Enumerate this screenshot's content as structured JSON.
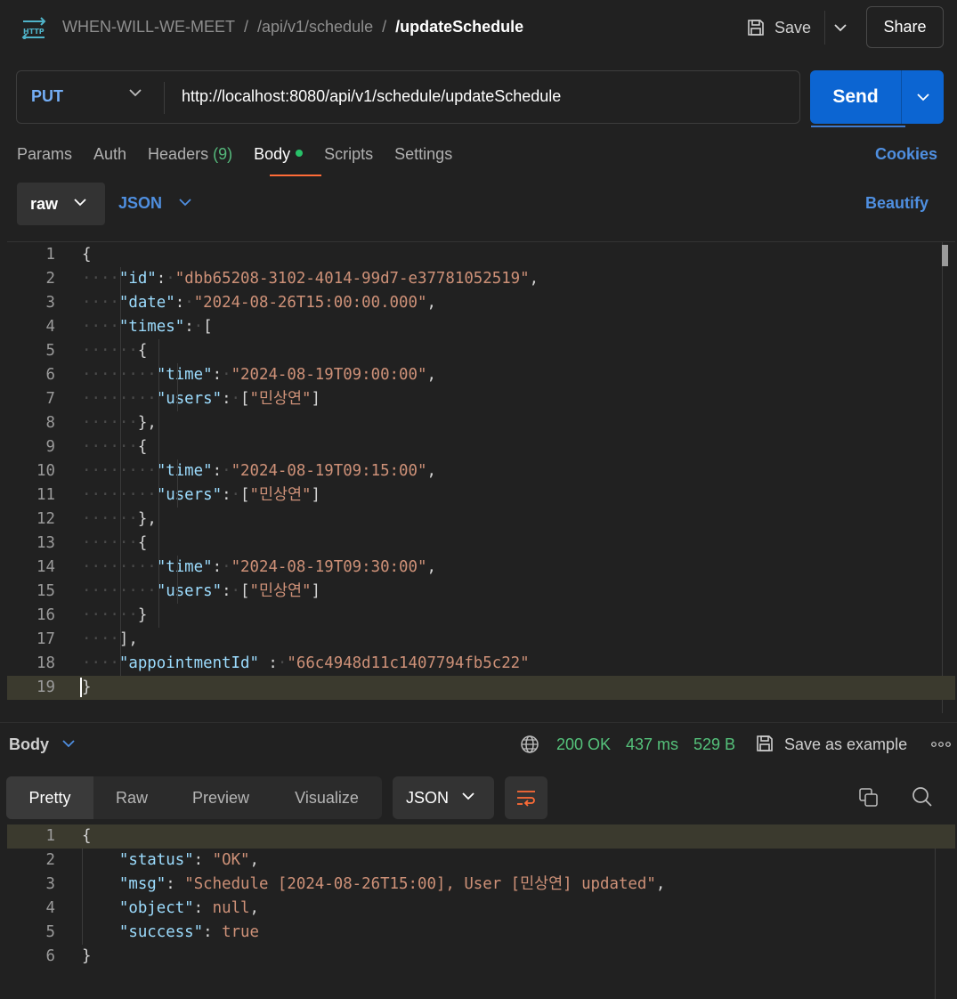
{
  "header": {
    "icon": "http-icon",
    "breadcrumbs": [
      "WHEN-WILL-WE-MEET",
      "/api/v1/schedule",
      "/updateSchedule"
    ],
    "separator": "/",
    "save_label": "Save",
    "share_label": "Share"
  },
  "request": {
    "method": "PUT",
    "url": "http://localhost:8080/api/v1/schedule/updateSchedule",
    "send_label": "Send"
  },
  "tabs": {
    "items": [
      {
        "label": "Params"
      },
      {
        "label": "Auth"
      },
      {
        "label": "Headers",
        "count": "(9)"
      },
      {
        "label": "Body",
        "active": true
      },
      {
        "label": "Scripts"
      },
      {
        "label": "Settings"
      }
    ],
    "cookies_label": "Cookies"
  },
  "body_options": {
    "mode": "raw",
    "language": "JSON",
    "beautify_label": "Beautify"
  },
  "request_body": {
    "lines": [
      {
        "n": "1",
        "text": "{"
      },
      {
        "n": "2",
        "text": "    \"id\": \"dbb65208-3102-4014-99d7-e37781052519\","
      },
      {
        "n": "3",
        "text": "    \"date\": \"2024-08-26T15:00:00.000\","
      },
      {
        "n": "4",
        "text": "    \"times\": ["
      },
      {
        "n": "5",
        "text": "      {"
      },
      {
        "n": "6",
        "text": "        \"time\": \"2024-08-19T09:00:00\","
      },
      {
        "n": "7",
        "text": "        \"users\": [\"민상연\"]"
      },
      {
        "n": "8",
        "text": "      },"
      },
      {
        "n": "9",
        "text": "      {"
      },
      {
        "n": "10",
        "text": "        \"time\": \"2024-08-19T09:15:00\","
      },
      {
        "n": "11",
        "text": "        \"users\": [\"민상연\"]"
      },
      {
        "n": "12",
        "text": "      },"
      },
      {
        "n": "13",
        "text": "      {"
      },
      {
        "n": "14",
        "text": "        \"time\": \"2024-08-19T09:30:00\","
      },
      {
        "n": "15",
        "text": "        \"users\": [\"민상연\"]"
      },
      {
        "n": "16",
        "text": "      }"
      },
      {
        "n": "17",
        "text": "    ],"
      },
      {
        "n": "18",
        "text": "    \"appointmentId\" : \"66c4948d11c1407794fb5c22\""
      },
      {
        "n": "19",
        "text": "}"
      }
    ]
  },
  "response": {
    "label": "Body",
    "status": "200 OK",
    "time": "437 ms",
    "size": "529 B",
    "save_example_label": "Save as example",
    "view_tabs": [
      "Pretty",
      "Raw",
      "Preview",
      "Visualize"
    ],
    "format": "JSON",
    "lines": [
      {
        "n": "1",
        "text": "{"
      },
      {
        "n": "2",
        "text": "    \"status\": \"OK\","
      },
      {
        "n": "3",
        "text": "    \"msg\": \"Schedule [2024-08-26T15:00], User [민상연] updated\","
      },
      {
        "n": "4",
        "text": "    \"object\": null,"
      },
      {
        "n": "5",
        "text": "    \"success\": true"
      },
      {
        "n": "6",
        "text": "}"
      }
    ]
  },
  "colors": {
    "accent": "#ff6c37",
    "send": "#0c65d2",
    "link": "#4f8fe0",
    "success": "#55c27b",
    "json_key": "#9cdcfe",
    "json_string": "#ce9178"
  }
}
